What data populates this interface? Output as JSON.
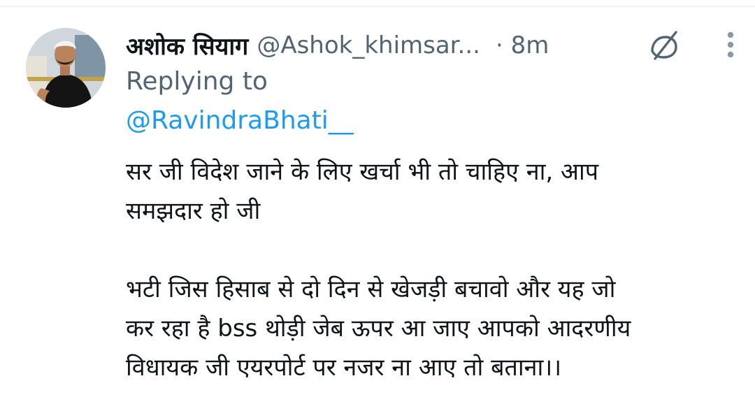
{
  "tweet": {
    "author_name": "अशोक सियाग",
    "author_handle": "@Ashok_khimsar...",
    "time": "· 8m",
    "replying_to_label": "Replying to",
    "replying_to_handle": "@RavindraBhati__",
    "body": {
      "line1": "सर जी विदेश जाने के लिए खर्चा भी तो चाहिए ना, आप",
      "line2": "समझदार हो जी",
      "line3": "भटी जिस हिसाब से दो दिन से खेजड़ी बचावो और यह जो",
      "line4": "कर रहा है bss थोड़ी जेब ऊपर आ जाए आपको आदरणीय",
      "line5": "विधायक जी एयरपोर्ट पर नजर ना आए तो बताना।।"
    },
    "icons": {
      "muted": "muted-conversation-icon",
      "more": "more-options-icon"
    },
    "colors": {
      "text": "#0f1419",
      "secondary": "#536471",
      "link": "#1d9bf0"
    }
  }
}
